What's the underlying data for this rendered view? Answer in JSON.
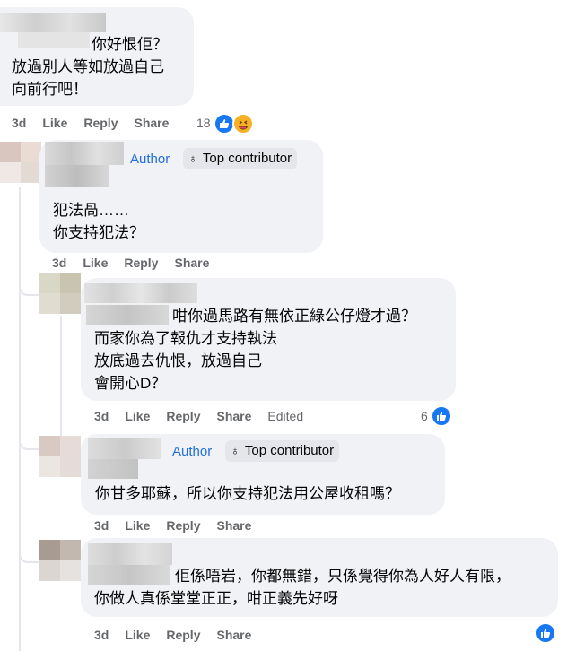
{
  "comments": [
    {
      "text": [
        "你好恨佢？",
        "放過別人等如放過自己",
        "向前行吧！"
      ],
      "actions": {
        "time": "3d",
        "like": "Like",
        "reply": "Reply",
        "share": "Share"
      },
      "reaction_count": "18",
      "reactions": [
        "like-icon",
        "haha-icon"
      ]
    },
    {
      "author_label": "Author",
      "badge": "Top contributor",
      "text": [
        "犯法咼……",
        "你支持犯法？"
      ],
      "actions": {
        "time": "3d",
        "like": "Like",
        "reply": "Reply",
        "share": "Share"
      }
    },
    {
      "text": [
        "咁你過馬路有無依正綠公仔燈才過？",
        "而家你為了報仇才支持執法",
        "放底過去仇恨，放過自己",
        "會開心D？"
      ],
      "actions": {
        "time": "3d",
        "like": "Like",
        "reply": "Reply",
        "share": "Share",
        "edited": "Edited"
      },
      "reaction_count": "6",
      "reactions": [
        "like-icon"
      ]
    },
    {
      "author_label": "Author",
      "badge": "Top contributor",
      "text": [
        "你甘多耶蘇，所以你支持犯法用公屋收租嗎？"
      ],
      "actions": {
        "time": "3d",
        "like": "Like",
        "reply": "Reply",
        "share": "Share"
      }
    },
    {
      "text": [
        "佢係唔岩，你都無錯，只係覺得你為人好人有限，",
        "你做人真係堂堂正正，咁正義先好呀"
      ],
      "actions": {
        "time": "3d",
        "like": "Like",
        "reply": "Reply",
        "share": "Share"
      },
      "reactions": [
        "like-icon"
      ]
    }
  ],
  "colors": {
    "bubble": "#f0f2f5",
    "author": "#216fdb",
    "muted": "#65676b",
    "like": "#1877f2"
  }
}
